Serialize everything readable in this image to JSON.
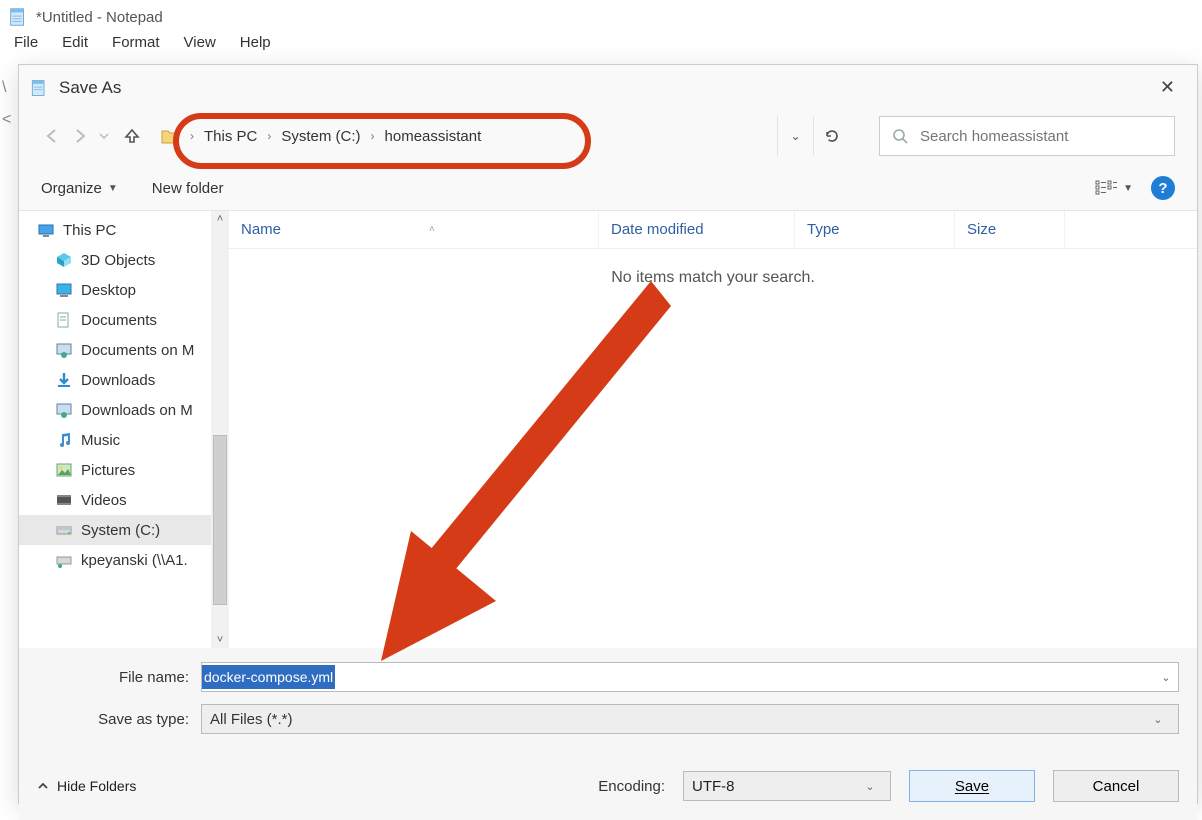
{
  "notepad": {
    "title": "*Untitled - Notepad",
    "menu": [
      "File",
      "Edit",
      "Format",
      "View",
      "Help"
    ]
  },
  "dialog": {
    "title": "Save As",
    "breadcrumb": [
      "This PC",
      "System (C:)",
      "homeassistant"
    ],
    "search_placeholder": "Search homeassistant",
    "organize_label": "Organize",
    "newfolder_label": "New folder",
    "columns": {
      "name": "Name",
      "date": "Date modified",
      "type": "Type",
      "size": "Size"
    },
    "empty_message": "No items match your search.",
    "tree": [
      {
        "label": "This PC",
        "icon": "pc",
        "indent": 0
      },
      {
        "label": "3D Objects",
        "icon": "3d",
        "indent": 1
      },
      {
        "label": "Desktop",
        "icon": "desktop",
        "indent": 1
      },
      {
        "label": "Documents",
        "icon": "docs",
        "indent": 1
      },
      {
        "label": "Documents on M",
        "icon": "net",
        "indent": 1
      },
      {
        "label": "Downloads",
        "icon": "down",
        "indent": 1
      },
      {
        "label": "Downloads on M",
        "icon": "net",
        "indent": 1
      },
      {
        "label": "Music",
        "icon": "music",
        "indent": 1
      },
      {
        "label": "Pictures",
        "icon": "pics",
        "indent": 1
      },
      {
        "label": "Videos",
        "icon": "video",
        "indent": 1
      },
      {
        "label": "System (C:)",
        "icon": "drive",
        "indent": 1,
        "selected": true
      },
      {
        "label": "kpeyanski (\\\\A1.",
        "icon": "netdrive",
        "indent": 1
      }
    ],
    "file_name_label": "File name:",
    "file_name_value": "docker-compose.yml",
    "save_as_type_label": "Save as type:",
    "save_as_type_value": "All Files  (*.*)",
    "encoding_label": "Encoding:",
    "encoding_value": "UTF-8",
    "hide_folders_label": "Hide Folders",
    "save_label": "Save",
    "cancel_label": "Cancel"
  }
}
